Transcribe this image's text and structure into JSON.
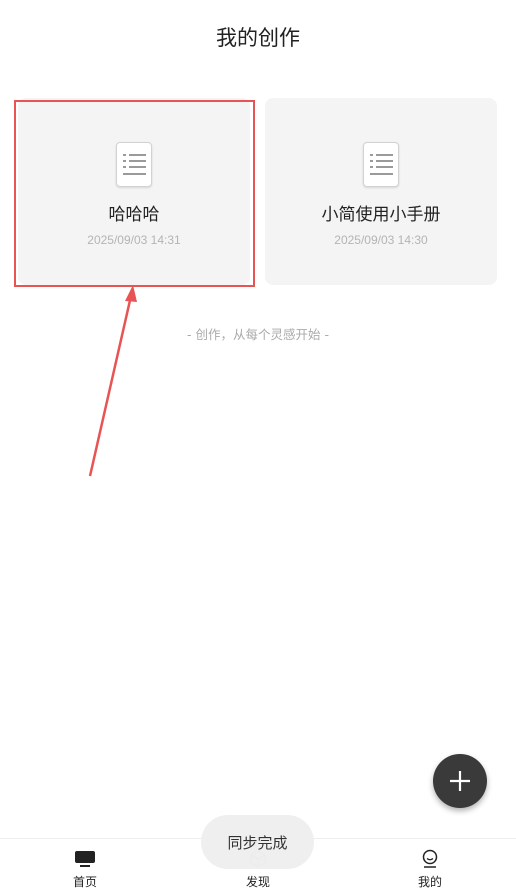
{
  "header": {
    "title": "我的创作"
  },
  "cards": [
    {
      "title": "哈哈哈",
      "date": "2025/09/03 14:31",
      "icon": "document-icon"
    },
    {
      "title": "小简使用小手册",
      "date": "2025/09/03 14:30",
      "icon": "document-icon"
    }
  ],
  "slogan": "- 创作，从每个灵感开始 -",
  "fab": {
    "icon": "plus-icon"
  },
  "toast": {
    "text": "同步完成"
  },
  "bottom_nav": {
    "items": [
      {
        "label": "首页",
        "icon": "monitor-icon",
        "active": true
      },
      {
        "label": "发现",
        "icon": "cube-icon",
        "active": false
      },
      {
        "label": "我的",
        "icon": "user-icon",
        "active": false
      }
    ]
  },
  "colors": {
    "highlight": "#e85454",
    "fab": "#3a3a3a",
    "card_bg": "#f4f4f4"
  }
}
